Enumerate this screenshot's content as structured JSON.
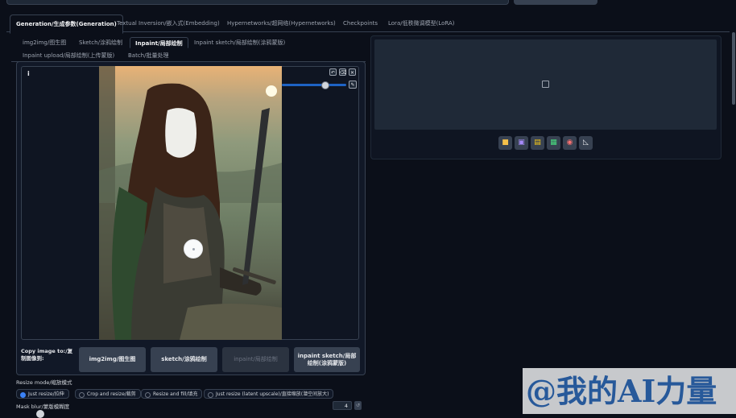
{
  "main_tabs": [
    {
      "label": "Generation/生成参数(Generation)",
      "selected": true
    },
    {
      "label": "Textual Inversion/嵌入式(Embedding)",
      "selected": false
    },
    {
      "label": "Hypernetworks/超网络(Hypernetworks)",
      "selected": false
    },
    {
      "label": "Checkpoints",
      "selected": false
    },
    {
      "label": "Lora/低秩微调模型(LoRA)",
      "selected": false
    }
  ],
  "img_tabs": [
    {
      "label": "img2img/图生图",
      "selected": false
    },
    {
      "label": "Sketch/涂鸦绘制",
      "selected": false
    },
    {
      "label": "Inpaint/局部绘制",
      "selected": true
    },
    {
      "label": "Inpaint sketch/局部绘制(涂鸦蒙版)",
      "selected": false
    },
    {
      "label": "Inpaint upload/局部绘制(上传蒙版)",
      "selected": false
    },
    {
      "label": "Batch/批量处理",
      "selected": false
    }
  ],
  "editor": {
    "info_icon": "i",
    "tools": {
      "undo_icon": "undo-icon",
      "clear_icon": "eraser-icon",
      "close_icon": "close-icon",
      "brush_icon": "brush-icon"
    },
    "brush_size_fraction": 0.66
  },
  "copy_image": {
    "label": "Copy image to:/复制图像到:",
    "buttons": [
      "img2img/图生图",
      "sketch/涂鸦绘制",
      "inpaint/局部绘制",
      "inpaint sketch/局部绘制(涂鸦蒙版)"
    ]
  },
  "resize_mode": {
    "label": "Resize mode/缩放模式",
    "options": [
      {
        "label": "Just resize/拉伸",
        "selected": true
      },
      {
        "label": "Crop and resize/裁剪",
        "selected": false
      },
      {
        "label": "Resize and fill/填充",
        "selected": false
      },
      {
        "label": "Just resize (latent upscale)/直接缩放(潜空间放大)",
        "selected": false
      }
    ]
  },
  "mask_blur": {
    "label": "Mask blur/蒙版模糊度",
    "value": "4"
  },
  "output_toolbar": [
    "folder-icon",
    "save-icon",
    "zip-icon",
    "send-to-img2img-icon",
    "send-to-inpaint-icon",
    "send-to-extras-icon"
  ],
  "watermark": "@我的AI力量",
  "colors": {
    "accent": "#3b82f6",
    "background": "#0b0f19",
    "panel": "#1f2937"
  }
}
